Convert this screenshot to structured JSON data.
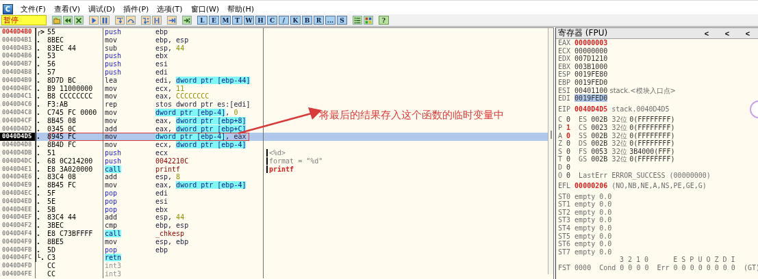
{
  "menu": {
    "app_icon": "C",
    "items": [
      "文件(F)",
      "查看(V)",
      "调试(D)",
      "插件(P)",
      "选项(T)",
      "窗口(W)",
      "帮助(H)"
    ]
  },
  "toolbar": {
    "status": "暂停",
    "window_buttons": [
      "L",
      "E",
      "M",
      "T",
      "W",
      "H",
      "C",
      "/",
      "K",
      "B",
      "R",
      "...",
      "S"
    ],
    "help": "?"
  },
  "disassembly": {
    "rows": [
      {
        "address": "0040D4B0",
        "entry": true,
        "selected": false,
        "marker": "┌>",
        "hex": "55",
        "mnemonic": "push",
        "kind": "stack",
        "operands": [
          {
            "t": "ebp",
            "kind": "plain"
          }
        ]
      },
      {
        "address": "0040D4B1",
        "entry": false,
        "selected": false,
        "marker": ".",
        "hex": "8BEC",
        "mnemonic": "mov",
        "kind": "plain",
        "operands": [
          {
            "t": "ebp, esp",
            "kind": "plain"
          }
        ]
      },
      {
        "address": "0040D4B3",
        "entry": false,
        "selected": false,
        "marker": ".",
        "hex": "83EC 44",
        "mnemonic": "sub",
        "kind": "plain",
        "operands": [
          {
            "t": "esp, ",
            "kind": "plain"
          },
          {
            "t": "44",
            "kind": "num"
          }
        ]
      },
      {
        "address": "0040D4B6",
        "entry": false,
        "selected": false,
        "marker": ".",
        "hex": "53",
        "mnemonic": "push",
        "kind": "stack",
        "operands": [
          {
            "t": "ebx",
            "kind": "plain"
          }
        ]
      },
      {
        "address": "0040D4B7",
        "entry": false,
        "selected": false,
        "marker": ".",
        "hex": "56",
        "mnemonic": "push",
        "kind": "stack",
        "operands": [
          {
            "t": "esi",
            "kind": "plain"
          }
        ]
      },
      {
        "address": "0040D4B8",
        "entry": false,
        "selected": false,
        "marker": ".",
        "hex": "57",
        "mnemonic": "push",
        "kind": "stack",
        "operands": [
          {
            "t": "edi",
            "kind": "plain"
          }
        ]
      },
      {
        "address": "0040D4B9",
        "entry": false,
        "selected": false,
        "marker": ".",
        "hex": "8D7D BC",
        "mnemonic": "lea",
        "kind": "plain",
        "operands": [
          {
            "t": "edi, ",
            "kind": "plain"
          },
          {
            "t": "dword ptr [ebp-44]",
            "kind": "mem"
          }
        ]
      },
      {
        "address": "0040D4BC",
        "entry": false,
        "selected": false,
        "marker": ".",
        "hex": "B9 11000000",
        "mnemonic": "mov",
        "kind": "plain",
        "operands": [
          {
            "t": "ecx, ",
            "kind": "plain"
          },
          {
            "t": "11",
            "kind": "num"
          }
        ]
      },
      {
        "address": "0040D4C1",
        "entry": false,
        "selected": false,
        "marker": ".",
        "hex": "B8 CCCCCCCC",
        "mnemonic": "mov",
        "kind": "plain",
        "operands": [
          {
            "t": "eax, ",
            "kind": "plain"
          },
          {
            "t": "CCCCCCCC",
            "kind": "num"
          }
        ]
      },
      {
        "address": "0040D4C6",
        "entry": false,
        "selected": false,
        "marker": ".",
        "hex": "F3:AB",
        "mnemonic": "rep",
        "kind": "plain",
        "operands": [
          {
            "t": "stos dword ptr es:[edi]",
            "kind": "plain"
          }
        ]
      },
      {
        "address": "0040D4C8",
        "entry": false,
        "selected": false,
        "marker": ".",
        "hex": "C745 FC 0000",
        "mnemonic": "mov",
        "kind": "plain",
        "operands": [
          {
            "t": "dword ptr [ebp-4]",
            "kind": "mem"
          },
          {
            "t": ", ",
            "kind": "plain"
          },
          {
            "t": "0",
            "kind": "num"
          }
        ]
      },
      {
        "address": "0040D4CF",
        "entry": false,
        "selected": false,
        "marker": ".",
        "hex": "8B45 08",
        "mnemonic": "mov",
        "kind": "plain",
        "operands": [
          {
            "t": "eax, ",
            "kind": "plain"
          },
          {
            "t": "dword ptr [ebp+8]",
            "kind": "mem"
          }
        ]
      },
      {
        "address": "0040D4D2",
        "entry": false,
        "selected": false,
        "marker": ".",
        "hex": "0345 0C",
        "mnemonic": "add",
        "kind": "plain",
        "operands": [
          {
            "t": "eax, ",
            "kind": "plain"
          },
          {
            "t": "dword ptr [ebp+C]",
            "kind": "mem"
          }
        ]
      },
      {
        "address": "0040D4D5",
        "entry": false,
        "selected": true,
        "marker": ".",
        "hex": "8945 FC",
        "mnemonic": "mov",
        "kind": "plain",
        "operands": [
          {
            "t": "dword ptr [ebp-4]",
            "kind": "mem"
          },
          {
            "t": ", eax",
            "kind": "plain"
          }
        ]
      },
      {
        "address": "0040D4D8",
        "entry": false,
        "selected": false,
        "marker": ".",
        "hex": "8B4D FC",
        "mnemonic": "mov",
        "kind": "plain",
        "operands": [
          {
            "t": "ecx, ",
            "kind": "plain"
          },
          {
            "t": "dword ptr [ebp-4]",
            "kind": "mem"
          }
        ]
      },
      {
        "address": "0040D4DB",
        "entry": false,
        "selected": false,
        "marker": ".",
        "hex": "51",
        "mnemonic": "push",
        "kind": "stack",
        "operands": [
          {
            "t": "ecx",
            "kind": "plain"
          }
        ],
        "comment": {
          "text": "<%d>",
          "kind": "arg"
        }
      },
      {
        "address": "0040D4DC",
        "entry": false,
        "selected": false,
        "marker": ".",
        "hex": "68 0C214200",
        "mnemonic": "push",
        "kind": "stack",
        "operands": [
          {
            "t": "0042210C",
            "kind": "sym"
          }
        ],
        "comment": {
          "text": "format = \"%d\"",
          "kind": "arg"
        }
      },
      {
        "address": "0040D4E1",
        "entry": false,
        "selected": false,
        "marker": ".",
        "hex": "E8 3A020000",
        "mnemonic": "call",
        "kind": "call",
        "operands": [
          {
            "t": "printf",
            "kind": "sym"
          }
        ],
        "comment": {
          "text": "printf",
          "kind": "func"
        }
      },
      {
        "address": "0040D4E6",
        "entry": false,
        "selected": false,
        "marker": ".",
        "hex": "83C4 08",
        "mnemonic": "add",
        "kind": "plain",
        "operands": [
          {
            "t": "esp, ",
            "kind": "plain"
          },
          {
            "t": "8",
            "kind": "num"
          }
        ]
      },
      {
        "address": "0040D4E9",
        "entry": false,
        "selected": false,
        "marker": ".",
        "hex": "8B45 FC",
        "mnemonic": "mov",
        "kind": "plain",
        "operands": [
          {
            "t": "eax, ",
            "kind": "plain"
          },
          {
            "t": "dword ptr [ebp-4]",
            "kind": "mem"
          }
        ]
      },
      {
        "address": "0040D4EC",
        "entry": false,
        "selected": false,
        "marker": ".",
        "hex": "5F",
        "mnemonic": "pop",
        "kind": "stack",
        "operands": [
          {
            "t": "edi",
            "kind": "plain"
          }
        ]
      },
      {
        "address": "0040D4ED",
        "entry": false,
        "selected": false,
        "marker": ".",
        "hex": "5E",
        "mnemonic": "pop",
        "kind": "stack",
        "operands": [
          {
            "t": "esi",
            "kind": "plain"
          }
        ]
      },
      {
        "address": "0040D4EE",
        "entry": false,
        "selected": false,
        "marker": ".",
        "hex": "5B",
        "mnemonic": "pop",
        "kind": "stack",
        "operands": [
          {
            "t": "ebx",
            "kind": "plain"
          }
        ]
      },
      {
        "address": "0040D4EF",
        "entry": false,
        "selected": false,
        "marker": ".",
        "hex": "83C4 44",
        "mnemonic": "add",
        "kind": "plain",
        "operands": [
          {
            "t": "esp, ",
            "kind": "plain"
          },
          {
            "t": "44",
            "kind": "num"
          }
        ]
      },
      {
        "address": "0040D4F2",
        "entry": false,
        "selected": false,
        "marker": ".",
        "hex": "3BEC",
        "mnemonic": "cmp",
        "kind": "plain",
        "operands": [
          {
            "t": "ebp, esp",
            "kind": "plain"
          }
        ]
      },
      {
        "address": "0040D4F4",
        "entry": false,
        "selected": false,
        "marker": ".",
        "hex": "E8 C73BFFFF",
        "mnemonic": "call",
        "kind": "call",
        "operands": [
          {
            "t": "_chkesp",
            "kind": "sym"
          }
        ]
      },
      {
        "address": "0040D4F9",
        "entry": false,
        "selected": false,
        "marker": ".",
        "hex": "8BE5",
        "mnemonic": "mov",
        "kind": "plain",
        "operands": [
          {
            "t": "esp, ebp",
            "kind": "plain"
          }
        ]
      },
      {
        "address": "0040D4FB",
        "entry": false,
        "selected": false,
        "marker": ".",
        "hex": "5D",
        "mnemonic": "pop",
        "kind": "stack",
        "operands": [
          {
            "t": "ebp",
            "kind": "plain"
          }
        ]
      },
      {
        "address": "0040D4FC",
        "entry": false,
        "selected": false,
        "marker": "└.",
        "hex": "C3",
        "mnemonic": "retn",
        "kind": "call",
        "operands": []
      },
      {
        "address": "0040D4FD",
        "entry": false,
        "selected": false,
        "marker": "",
        "hex": "CC",
        "mnemonic": "int3",
        "kind": "pad",
        "operands": []
      },
      {
        "address": "0040D4FE",
        "entry": false,
        "selected": false,
        "marker": "",
        "hex": "CC",
        "mnemonic": "int3",
        "kind": "pad",
        "operands": []
      }
    ],
    "annotation": {
      "text": "将最后的结果存入这个函数的临时变量中"
    }
  },
  "registers": {
    "title": "寄存器 (FPU)",
    "nav": [
      "<",
      "<",
      "<"
    ],
    "general": [
      {
        "name": "EAX",
        "value": "00000003",
        "changed": true,
        "selected": false
      },
      {
        "name": "ECX",
        "value": "00000000",
        "changed": false,
        "selected": false
      },
      {
        "name": "EDX",
        "value": "007D1210",
        "changed": false,
        "selected": false
      },
      {
        "name": "EBX",
        "value": "003B1000",
        "changed": false,
        "selected": false
      },
      {
        "name": "ESP",
        "value": "0019FE80",
        "changed": false,
        "selected": false
      },
      {
        "name": "EBP",
        "value": "0019FED0",
        "changed": false,
        "selected": false
      },
      {
        "name": "ESI",
        "value": "00401100",
        "changed": false,
        "selected": false,
        "note": "stack.<模块入口点>"
      },
      {
        "name": "EDI",
        "value": "0019FED0",
        "changed": false,
        "selected": true
      }
    ],
    "eip": {
      "name": "EIP",
      "value": "0040D4D5",
      "changed": true,
      "note": "stack.0040D4D5"
    },
    "flags": [
      {
        "flag": "C",
        "bit": "0",
        "changed": false,
        "seg": "ES",
        "selector": "002B",
        "bits": "32位",
        "base": "0(FFFFFFFF)"
      },
      {
        "flag": "P",
        "bit": "1",
        "changed": true,
        "seg": "CS",
        "selector": "0023",
        "bits": "32位",
        "base": "0(FFFFFFFF)"
      },
      {
        "flag": "A",
        "bit": "0",
        "changed": true,
        "seg": "SS",
        "selector": "002B",
        "bits": "32位",
        "base": "0(FFFFFFFF)"
      },
      {
        "flag": "Z",
        "bit": "0",
        "changed": false,
        "seg": "DS",
        "selector": "002B",
        "bits": "32位",
        "base": "0(FFFFFFFF)"
      },
      {
        "flag": "S",
        "bit": "0",
        "changed": false,
        "seg": "FS",
        "selector": "0053",
        "bits": "32位",
        "base": "3B4000(FFF)"
      },
      {
        "flag": "T",
        "bit": "0",
        "changed": false,
        "seg": "GS",
        "selector": "002B",
        "bits": "32位",
        "base": "0(FFFFFFFF)"
      },
      {
        "flag": "D",
        "bit": "0",
        "changed": false
      },
      {
        "flag": "O",
        "bit": "0",
        "changed": false,
        "extra": "LastErr ERROR_SUCCESS (00000000)"
      }
    ],
    "efl": {
      "name": "EFL",
      "value": "00000206",
      "changed": true,
      "note": "(NO,NB,NE,A,NS,PE,GE,G)"
    },
    "fpu": [
      {
        "name": "ST0",
        "value": "empty 0.0"
      },
      {
        "name": "ST1",
        "value": "empty 0.0"
      },
      {
        "name": "ST2",
        "value": "empty 0.0"
      },
      {
        "name": "ST3",
        "value": "empty 0.0"
      },
      {
        "name": "ST4",
        "value": "empty 0.0"
      },
      {
        "name": "ST5",
        "value": "empty 0.0"
      },
      {
        "name": "ST6",
        "value": "empty 0.0"
      },
      {
        "name": "ST7",
        "value": "empty 0.0"
      }
    ],
    "fst_header": "3 2 1 0      E S P U O Z D I",
    "fst": "FST 0000  Cond 0 0 0 0  Err 0 0 0 0 0 0 0 0  (GT)"
  }
}
